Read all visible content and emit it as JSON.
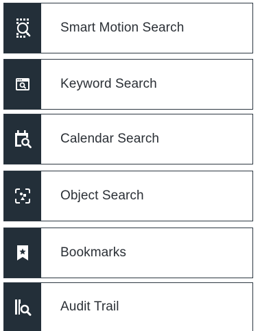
{
  "menu": {
    "items": [
      {
        "label": "Smart Motion Search",
        "icon": "smart-motion-icon"
      },
      {
        "label": "Keyword Search",
        "icon": "keyword-search-icon"
      },
      {
        "label": "Calendar Search",
        "icon": "calendar-search-icon"
      },
      {
        "label": "Object Search",
        "icon": "object-search-icon"
      },
      {
        "label": "Bookmarks",
        "icon": "bookmark-icon"
      },
      {
        "label": "Audit Trail",
        "icon": "audit-trail-icon"
      }
    ]
  },
  "colors": {
    "icon_background": "#232f39",
    "icon_foreground": "#ffffff",
    "border": "#2b3640",
    "text": "#2a2f35",
    "background": "#ffffff"
  }
}
